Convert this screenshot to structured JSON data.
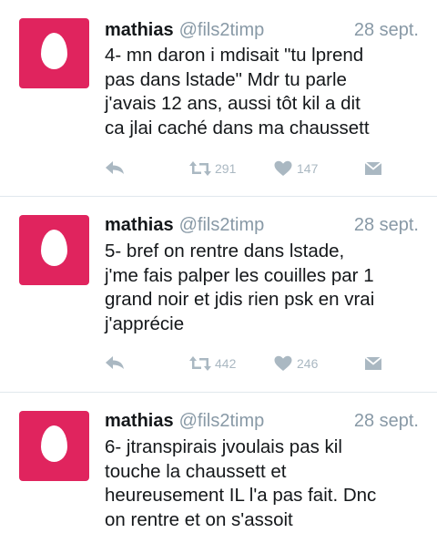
{
  "tweets": [
    {
      "name": "mathias",
      "handle": "@fils2timp",
      "date": "28 sept.",
      "text": "4- mn daron i mdisait \"tu lprend\npas dans lstade\" Mdr tu parle\nj'avais 12 ans, aussi tôt kil a dit\nca jlai caché dans ma chaussett",
      "retweets": "291",
      "likes": "147",
      "icons": {
        "avatar": "default-egg-avatar",
        "reply": "reply-icon",
        "retweet": "retweet-icon",
        "like": "heart-icon",
        "dm": "message-icon"
      }
    },
    {
      "name": "mathias",
      "handle": "@fils2timp",
      "date": "28 sept.",
      "text": "5- bref on rentre dans lstade,\nj'me fais palper les couilles par 1\ngrand noir et jdis rien psk en vrai\nj'apprécie",
      "retweets": "442",
      "likes": "246"
    },
    {
      "name": "mathias",
      "handle": "@fils2timp",
      "date": "28 sept.",
      "text": "6- jtranspirais jvoulais pas kil\ntouche la chaussett et\nheureusement IL l'a pas fait. Dnc\non rentre et on s'assoit"
    }
  ],
  "colors": {
    "avatar": "#e0245e",
    "muted": "#8899a6",
    "icon": "#aab8c2",
    "text": "#14171a",
    "divider": "#e1e8ed"
  }
}
